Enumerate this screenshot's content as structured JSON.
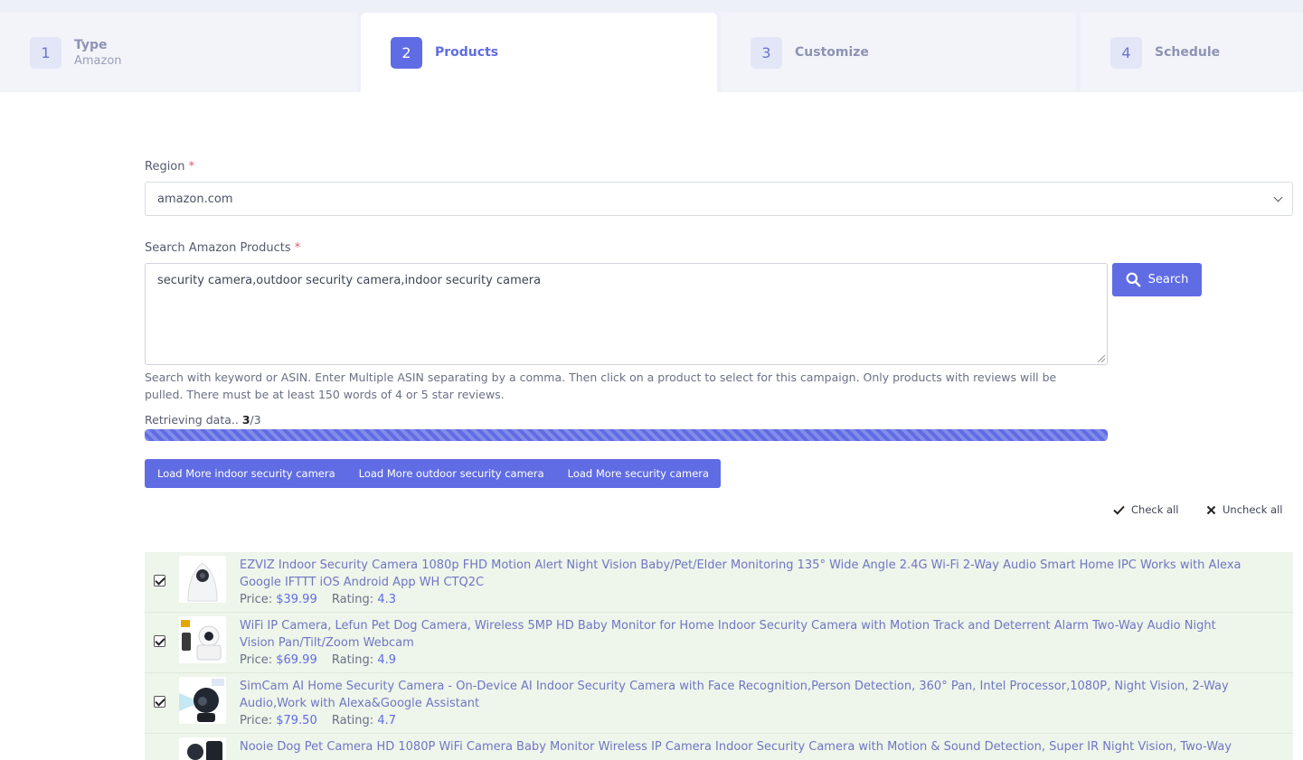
{
  "steps": [
    {
      "number": "1",
      "title": "Type",
      "subtitle": "Amazon"
    },
    {
      "number": "2",
      "title": "Products",
      "subtitle": ""
    },
    {
      "number": "3",
      "title": "Customize",
      "subtitle": ""
    },
    {
      "number": "4",
      "title": "Schedule",
      "subtitle": ""
    }
  ],
  "region": {
    "label": "Region",
    "required": "*",
    "value": "amazon.com"
  },
  "search": {
    "label": "Search Amazon Products",
    "required": "*",
    "value": "security camera,outdoor security camera,indoor security camera",
    "button_label": "Search",
    "help_text": "Search with keyword or ASIN. Enter Multiple ASIN separating by a comma. Then click on a product to select for this campaign. Only products with reviews will be pulled. There must be at least 150 words of 4 or 5 star reviews."
  },
  "progress": {
    "label": "Retrieving data..",
    "current": "3",
    "total": "/3",
    "fraction": 1.0
  },
  "load_more": [
    "Load More indoor security camera",
    "Load More outdoor security camera",
    "Load More security camera"
  ],
  "check_all_label": "Check all",
  "uncheck_all_label": "Uncheck all",
  "products": [
    {
      "title": "EZVIZ Indoor Security Camera 1080p FHD Motion Alert Night Vision Baby/Pet/Elder Monitoring 135° Wide Angle 2.4G Wi-Fi 2-Way Audio Smart Home IPC Works with Alexa Google IFTTT iOS Android App WH CTQ2C",
      "price_label": "Price:",
      "price": "$39.99",
      "rating_label": "Rating:",
      "rating": "4.3",
      "checked": true
    },
    {
      "title": "WiFi IP Camera, Lefun Pet Dog Camera, Wireless 5MP HD Baby Monitor for Home Indoor Security Camera with Motion Track and Deterrent Alarm Two-Way Audio Night Vision Pan/Tilt/Zoom Webcam",
      "price_label": "Price:",
      "price": "$69.99",
      "rating_label": "Rating:",
      "rating": "4.9",
      "checked": true
    },
    {
      "title": "SimCam AI Home Security Camera - On-Device AI Indoor Security Camera with Face Recognition,Person Detection, 360° Pan, Intel Processor,1080P, Night Vision, 2-Way Audio,Work with Alexa&Google Assistant",
      "price_label": "Price:",
      "price": "$79.50",
      "rating_label": "Rating:",
      "rating": "4.7",
      "checked": true
    },
    {
      "title": "Nooie Dog Pet Camera HD 1080P WiFi Camera Baby Monitor Wireless IP Camera Indoor Security Camera with Motion & Sound Detection, Super IR Night Vision, Two-Way",
      "price_label": "",
      "price": "",
      "rating_label": "",
      "rating": "",
      "checked": false
    }
  ],
  "colors": {
    "accent": "#5f6ce3",
    "row_bg": "#eef5ea",
    "required": "#e5566a"
  }
}
